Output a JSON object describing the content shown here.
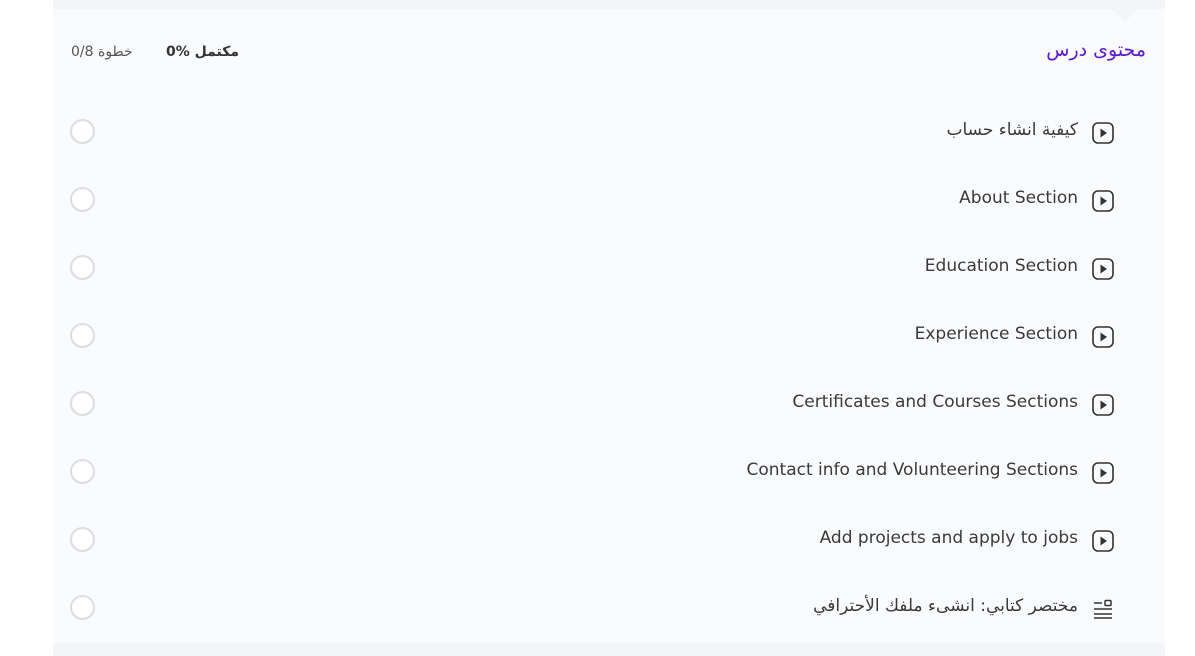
{
  "header": {
    "title": "محتوى درس",
    "progress": "0% مكتمل",
    "steps": "0/8 خطوة"
  },
  "lessons": [
    {
      "label": "كيفية انشاء حساب",
      "icon": "play-icon"
    },
    {
      "label": "About Section",
      "icon": "play-icon"
    },
    {
      "label": "Education Section",
      "icon": "play-icon"
    },
    {
      "label": "Experience Section",
      "icon": "play-icon"
    },
    {
      "label": "Certificates and Courses Sections",
      "icon": "play-icon"
    },
    {
      "label": "Contact info and Volunteering Sections",
      "icon": "play-icon"
    },
    {
      "label": "Add projects and apply to jobs",
      "icon": "play-icon"
    },
    {
      "label": "مختصر كتابي: انشىء ملفك الأحترافي",
      "icon": "text-doc-icon"
    }
  ],
  "colors": {
    "accent": "#5b17e6",
    "text": "#3a3a3a",
    "check_border": "#dcdde2"
  }
}
